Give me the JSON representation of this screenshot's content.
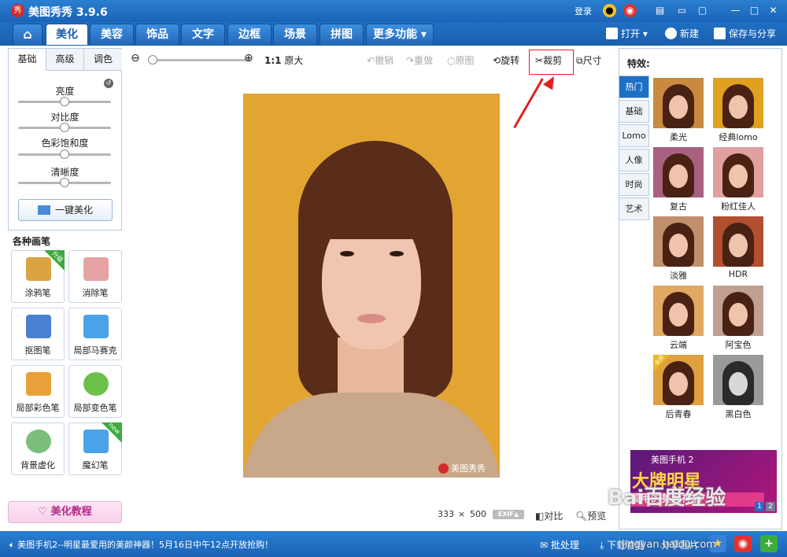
{
  "window": {
    "logo_glyph": "秀",
    "title": "美图秀秀 3.9.6",
    "login": "登录"
  },
  "menu": {
    "tabs": [
      {
        "label": "美化",
        "active": true
      },
      {
        "label": "美容"
      },
      {
        "label": "饰品"
      },
      {
        "label": "文字"
      },
      {
        "label": "边框"
      },
      {
        "label": "场景"
      },
      {
        "label": "拼图"
      },
      {
        "label": "更多功能 ▾"
      }
    ],
    "open": "打开",
    "new": "新建",
    "save_share": "保存与分享"
  },
  "adjust": {
    "tabs": [
      "基础",
      "高级",
      "调色"
    ],
    "sliders": [
      {
        "label": "亮度",
        "value": 0.5
      },
      {
        "label": "对比度",
        "value": 0.5
      },
      {
        "label": "色彩饱和度",
        "value": 0.5
      },
      {
        "label": "清晰度",
        "value": 0.5
      }
    ],
    "one_click": "一键美化"
  },
  "brushes": {
    "title": "各种画笔",
    "items": [
      {
        "label": "涂鸦笔",
        "badge": "升级",
        "color": "#d9a441"
      },
      {
        "label": "消除笔",
        "color": "#e7a3a3"
      },
      {
        "label": "抠图笔",
        "color": "#4b7fd0"
      },
      {
        "label": "局部马赛克",
        "color": "#4aa3e8"
      },
      {
        "label": "局部彩色笔",
        "color": "#e8a13a"
      },
      {
        "label": "局部变色笔",
        "color": "#6cc04a"
      },
      {
        "label": "背景虚化",
        "color": "#7bbf7b"
      },
      {
        "label": "魔幻笔",
        "badge": "new",
        "color": "#4aa3e8"
      }
    ]
  },
  "tutorial": "美化教程",
  "toolbar": {
    "zoom_original_prefix": "1:1",
    "zoom_original": "原大",
    "undo": "撤销",
    "redo": "重做",
    "original": "原图",
    "rotate": "旋转",
    "crop": "裁剪",
    "size": "尺寸"
  },
  "image": {
    "watermark": "美图秀秀",
    "width": "333",
    "times": "×",
    "height": "500",
    "exif": "EXIF▲",
    "compare": "对比",
    "preview": "预览"
  },
  "effects": {
    "title": "特效:",
    "categories": [
      {
        "label": "热门",
        "active": true
      },
      {
        "label": "基础"
      },
      {
        "label": "Lomo"
      },
      {
        "label": "人像"
      },
      {
        "label": "时尚"
      },
      {
        "label": "艺术"
      }
    ],
    "items": [
      {
        "label": "柔光",
        "tone": "#c98a40"
      },
      {
        "label": "经典lomo",
        "tone": "#e0a020"
      },
      {
        "label": "复古",
        "tone": "#a86080"
      },
      {
        "label": "粉红佳人",
        "tone": "#e0a0a0"
      },
      {
        "label": "淡雅",
        "tone": "#c0906c"
      },
      {
        "label": "HDR",
        "tone": "#b05030"
      },
      {
        "label": "云端",
        "tone": "#e0a860"
      },
      {
        "label": "阿宝色",
        "tone": "#c0a090"
      },
      {
        "label": "后青春",
        "tone": "#e0a040",
        "badge": "会员"
      },
      {
        "label": "黑白色",
        "tone": "#9a9a9a"
      }
    ]
  },
  "ad": {
    "top": "美图手机 2",
    "big": "大牌明星",
    "line": "爱用的美颜神器",
    "pages": [
      "1",
      "2"
    ]
  },
  "status": {
    "message": "美图手机2--明星最爱用的美颜神器！5月16日中午12点开放抢购！",
    "batch": "批处理",
    "download": "下载管理",
    "share": "分享图片"
  },
  "page_watermark": {
    "logo": "Bai百度经验",
    "url": "jingyan.baidu.com"
  }
}
